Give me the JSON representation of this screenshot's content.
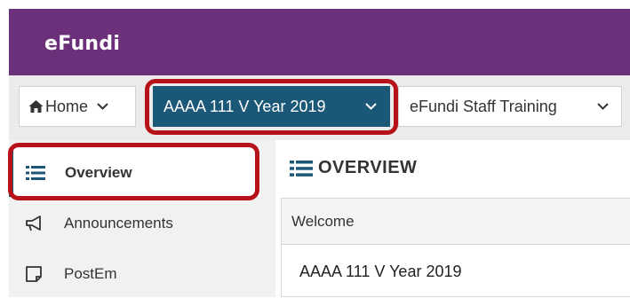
{
  "header": {
    "logo_text": "eFundi",
    "background": "#6b3079"
  },
  "tabs": [
    {
      "label": "Home",
      "icon": "home-icon",
      "active": false
    },
    {
      "label": "AAAA 111 V Year 2019",
      "active": true,
      "color": "#1b5878"
    },
    {
      "label": "eFundi Staff Training",
      "active": false
    }
  ],
  "sidebar": {
    "items": [
      {
        "label": "Overview",
        "icon": "list-icon",
        "active": true
      },
      {
        "label": "Announcements",
        "icon": "megaphone-icon",
        "active": false
      },
      {
        "label": "PostEm",
        "icon": "note-icon",
        "active": false
      }
    ]
  },
  "content": {
    "title": "OVERVIEW",
    "panel_title": "Welcome",
    "panel_text": "AAAA 111 V Year 2019"
  },
  "annotation_color": "#b7121a"
}
